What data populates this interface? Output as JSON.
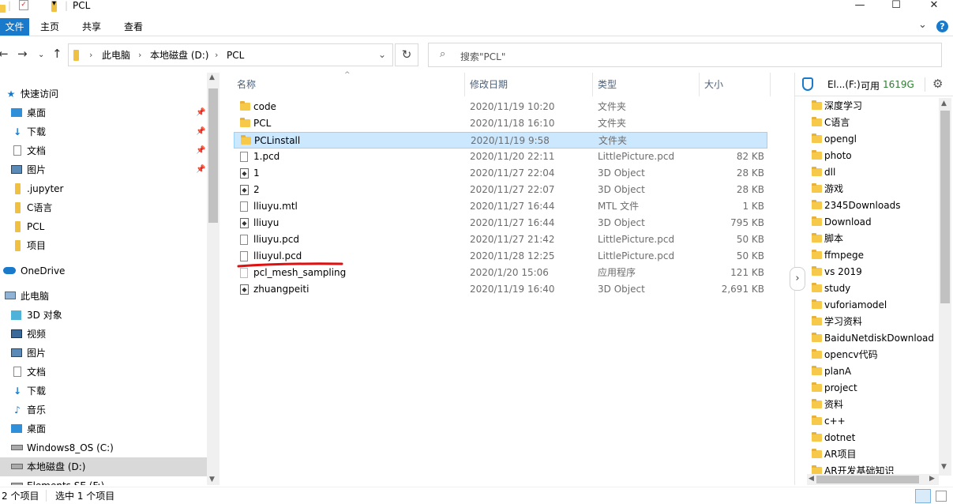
{
  "window": {
    "title": "PCL",
    "min_label": "—",
    "max_label": "☐",
    "close_label": "✕"
  },
  "ribbon": {
    "tabs": [
      "文件",
      "主页",
      "共享",
      "查看"
    ],
    "expand_label": "⌄",
    "help_label": "?"
  },
  "address": {
    "breadcrumbs": [
      "此电脑",
      "本地磁盘 (D:)",
      "PCL"
    ],
    "search_placeholder": "搜索\"PCL\""
  },
  "nav": {
    "items": [
      {
        "label": "快速访问",
        "icon": "star-icon",
        "pinned": false
      },
      {
        "label": "桌面",
        "icon": "desktop-icon",
        "pinned": true
      },
      {
        "label": "下载",
        "icon": "download-icon",
        "pinned": true
      },
      {
        "label": "文档",
        "icon": "document-icon",
        "pinned": true
      },
      {
        "label": "图片",
        "icon": "picture-icon",
        "pinned": true
      },
      {
        "label": ".jupyter",
        "icon": "folder-icon",
        "pinned": false
      },
      {
        "label": "C语言",
        "icon": "folder-icon",
        "pinned": false
      },
      {
        "label": "PCL",
        "icon": "folder-icon",
        "pinned": false
      },
      {
        "label": "项目",
        "icon": "folder-icon",
        "pinned": false
      },
      {
        "label": "OneDrive",
        "icon": "cloud-icon",
        "pinned": false
      },
      {
        "label": "此电脑",
        "icon": "computer-icon",
        "pinned": false
      },
      {
        "label": "3D 对象",
        "icon": "cube-icon",
        "pinned": false
      },
      {
        "label": "视频",
        "icon": "video-icon",
        "pinned": false
      },
      {
        "label": "图片",
        "icon": "picture-icon",
        "pinned": false
      },
      {
        "label": "文档",
        "icon": "document-icon",
        "pinned": false
      },
      {
        "label": "下载",
        "icon": "download-icon",
        "pinned": false
      },
      {
        "label": "音乐",
        "icon": "music-icon",
        "pinned": false
      },
      {
        "label": "桌面",
        "icon": "desktop-icon",
        "pinned": false
      },
      {
        "label": "Windows8_OS (C:)",
        "icon": "drive-icon",
        "pinned": false
      },
      {
        "label": "本地磁盘 (D:)",
        "icon": "drive-icon",
        "pinned": false
      },
      {
        "label": "Elements SE (F:)",
        "icon": "drive-icon",
        "pinned": false
      }
    ]
  },
  "list": {
    "columns": [
      "名称",
      "修改日期",
      "类型",
      "大小"
    ],
    "rows": [
      {
        "name": "code",
        "date": "2020/11/19 10:20",
        "type": "文件夹",
        "size": "",
        "kind": "folder"
      },
      {
        "name": "PCL",
        "date": "2020/11/18 16:10",
        "type": "文件夹",
        "size": "",
        "kind": "folder"
      },
      {
        "name": "PCLinstall",
        "date": "2020/11/19 9:58",
        "type": "文件夹",
        "size": "",
        "kind": "folder"
      },
      {
        "name": "1.pcd",
        "date": "2020/11/20 22:11",
        "type": "LittlePicture.pcd",
        "size": "82 KB",
        "kind": "file"
      },
      {
        "name": "1",
        "date": "2020/11/27 22:04",
        "type": "3D Object",
        "size": "28 KB",
        "kind": "object"
      },
      {
        "name": "2",
        "date": "2020/11/27 22:07",
        "type": "3D Object",
        "size": "28 KB",
        "kind": "object"
      },
      {
        "name": "lliuyu.mtl",
        "date": "2020/11/27 16:44",
        "type": "MTL 文件",
        "size": "1 KB",
        "kind": "file"
      },
      {
        "name": "lliuyu",
        "date": "2020/11/27 16:44",
        "type": "3D Object",
        "size": "795 KB",
        "kind": "object"
      },
      {
        "name": "lliuyu.pcd",
        "date": "2020/11/27 21:42",
        "type": "LittlePicture.pcd",
        "size": "50 KB",
        "kind": "file"
      },
      {
        "name": "lliuyul.pcd",
        "date": "2020/11/28 12:25",
        "type": "LittlePicture.pcd",
        "size": "50 KB",
        "kind": "file"
      },
      {
        "name": "pcl_mesh_sampling",
        "date": "2020/1/20 15:06",
        "type": "应用程序",
        "size": "121 KB",
        "kind": "exe"
      },
      {
        "name": "zhuangpeiti",
        "date": "2020/11/19 16:40",
        "type": "3D Object",
        "size": "2,691 KB",
        "kind": "object"
      }
    ]
  },
  "drive_panel": {
    "drive_label": "El...(F:)",
    "free_label": "可用",
    "free_value": "1619G",
    "folders": [
      "深度学习",
      "C语言",
      "opengl",
      "photo",
      "dll",
      "游戏",
      "2345Downloads",
      "Download",
      "脚本",
      "ffmpege",
      "vs 2019",
      "study",
      "vuforiamodel",
      "学习资料",
      "BaiduNetdiskDownload",
      "opencv代码",
      "planA",
      "project",
      "资料",
      "c++",
      "dotnet",
      "AR项目",
      "AR开发基础知识"
    ]
  },
  "status": {
    "count_text": "2 个项目",
    "selected_text": "选中 1 个项目"
  },
  "colors": {
    "accent": "#1979ca",
    "selection": "#cce8ff",
    "free_space": "#2e7d32",
    "annotation": "#e01010"
  }
}
